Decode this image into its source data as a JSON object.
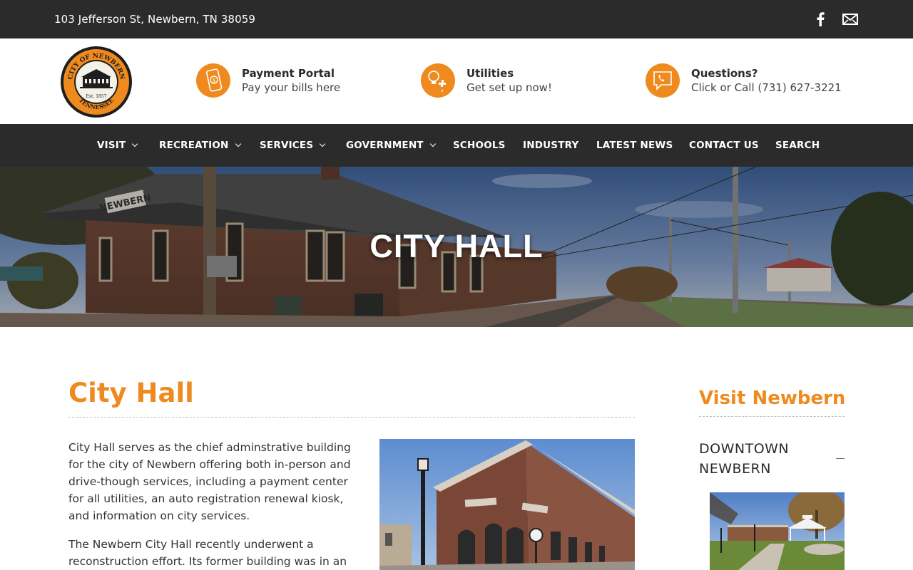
{
  "topbar": {
    "address": "103 Jefferson St, Newbern, TN 38059",
    "social": [
      {
        "icon": "facebook-icon"
      },
      {
        "icon": "mail-icon"
      }
    ]
  },
  "logo": {
    "top_text": "CITY OF NEWBERN",
    "bottom_text": "TENNESSEE",
    "est": "Est. 1857"
  },
  "features": [
    {
      "icon": "phone-dollar-icon",
      "title": "Payment Portal",
      "subtitle": "Pay your bills here"
    },
    {
      "icon": "bulb-faucet-icon",
      "title": "Utilities",
      "subtitle": "Get set up now!"
    },
    {
      "icon": "chat-phone-icon",
      "title": "Questions?",
      "subtitle": "Click or Call (731) 627-3221"
    }
  ],
  "nav": {
    "items": [
      {
        "label": "VISIT",
        "dropdown": true
      },
      {
        "label": "RECREATION",
        "dropdown": true
      },
      {
        "label": "SERVICES",
        "dropdown": true
      },
      {
        "label": "GOVERNMENT",
        "dropdown": true
      },
      {
        "label": "SCHOOLS",
        "dropdown": false
      },
      {
        "label": "INDUSTRY",
        "dropdown": false
      },
      {
        "label": "LATEST NEWS",
        "dropdown": false
      },
      {
        "label": "CONTACT US",
        "dropdown": false
      },
      {
        "label": "SEARCH",
        "dropdown": false
      }
    ]
  },
  "hero": {
    "title": "CITY HALL",
    "sign_text": "NEWBERN"
  },
  "main": {
    "title": "City Hall",
    "paragraph1": "City Hall serves as the chief adminstrative building for the city of Newbern offering both in-person and drive-though services, including a payment center for all utilities, an auto registration renewal kiosk, and information on city services.",
    "paragraph2": "The Newbern City Hall recently underwent a reconstruction effort. Its former building was in an"
  },
  "sidebar": {
    "title": "Visit Newbern",
    "item_label": "DOWNTOWN NEWBERN"
  },
  "colors": {
    "accent": "#ef8a1e",
    "dark": "#2b2b2b"
  }
}
